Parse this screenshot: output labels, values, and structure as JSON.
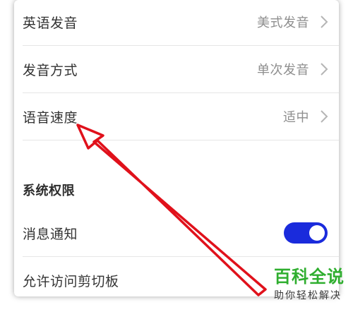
{
  "settings": {
    "rows": [
      {
        "label": "英语发音",
        "value": "美式发音"
      },
      {
        "label": "发音方式",
        "value": "单次发音"
      },
      {
        "label": "语音速度",
        "value": "适中"
      }
    ],
    "section_title": "系统权限",
    "notification": {
      "label": "消息通知",
      "toggle_on": true
    },
    "clipboard": {
      "label": "允许访问剪切板"
    }
  },
  "colors": {
    "toggle_on": "#1a2bdc",
    "annotation_arrow": "#e0111b",
    "watermark_green": "#2fae2f"
  },
  "watermark": {
    "main": "百科全说",
    "sub": "助你轻松解决"
  }
}
